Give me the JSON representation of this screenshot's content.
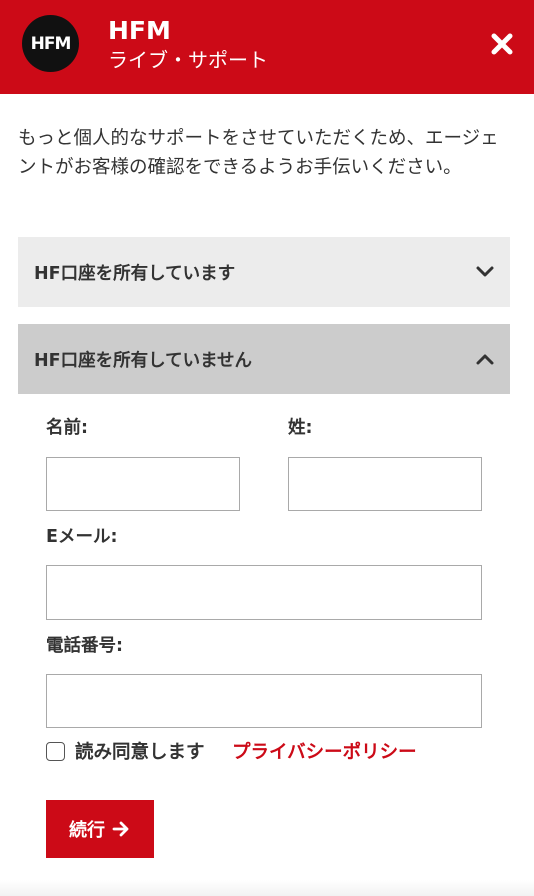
{
  "header": {
    "logo_text": "HFM",
    "brand": "HFM",
    "subtitle": "ライブ・サポート",
    "close_icon": "close-icon",
    "bg_color": "#cc0a17"
  },
  "intro_text": "もっと個人的なサポートをさせていただくため、エージェントがお客様の確認をできるようお手伝いください。",
  "accordions": [
    {
      "label": "HF口座を所有しています",
      "expanded": false,
      "icon": "chevron-down-icon"
    },
    {
      "label": "HF口座を所有していません",
      "expanded": true,
      "icon": "chevron-up-icon"
    }
  ],
  "form": {
    "first_name_label": "名前:",
    "first_name_value": "",
    "last_name_label": "姓:",
    "last_name_value": "",
    "email_label": "Eメール:",
    "email_value": "",
    "phone_label": "電話番号:",
    "phone_value": "",
    "agree_checked": false,
    "agree_text": "読み同意します",
    "privacy_link": "プライバシーポリシー",
    "submit_label": "続行",
    "submit_icon": "arrow-right-icon"
  },
  "colors": {
    "accent": "#cc0a17",
    "accordion_collapsed_bg": "#ececec",
    "accordion_expanded_bg": "#cccccc",
    "text": "#333333"
  }
}
